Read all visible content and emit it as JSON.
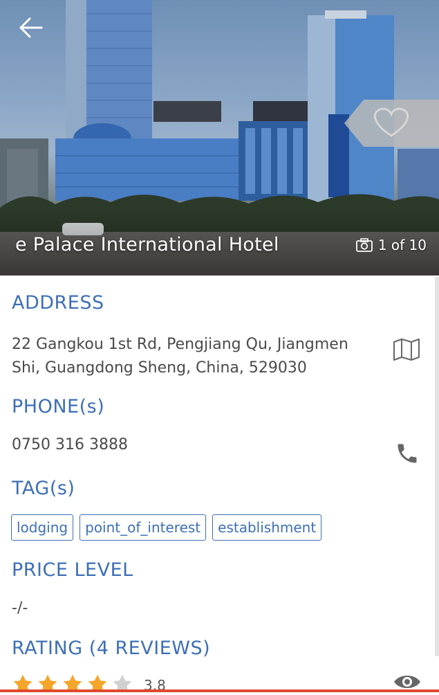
{
  "hotel": {
    "name": "e Palace International Hotel",
    "photo_counter": "1 of 10"
  },
  "address": {
    "heading": "ADDRESS",
    "line1": "22 Gangkou 1st Rd, Pengjiang Qu, Jiangmen",
    "line2": "Shi, Guangdong Sheng, China, 529030"
  },
  "phone": {
    "heading": "PHONE(s)",
    "number": "0750 316 3888"
  },
  "tags": {
    "heading": "TAG(s)",
    "items": [
      "lodging",
      "point_of_interest",
      "establishment"
    ]
  },
  "price": {
    "heading": "PRICE LEVEL",
    "value": "-/-"
  },
  "rating": {
    "heading": "RATING (4 REVIEWS)",
    "value": "3.8",
    "stars": 3.8
  },
  "colors": {
    "accent": "#3d6fb6",
    "text": "#4a4a4a",
    "star_filled": "#f4a62a",
    "star_empty": "#d0d0d0",
    "bottom_bar": "#e2492e"
  },
  "icons": [
    "back-arrow-icon",
    "heart-icon",
    "camera-icon",
    "map-icon",
    "phone-icon",
    "eye-icon",
    "star-icon"
  ]
}
